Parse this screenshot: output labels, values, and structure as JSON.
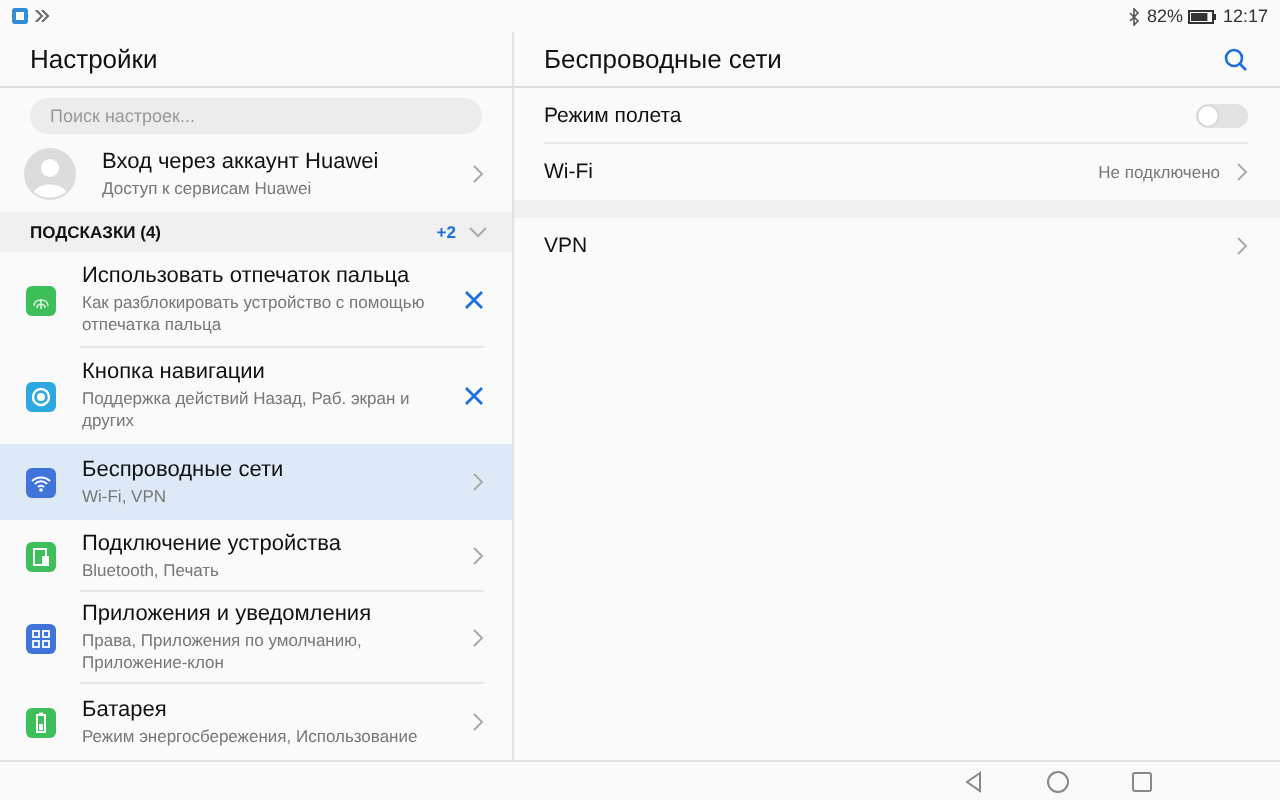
{
  "status_bar": {
    "battery": "82%",
    "time": "12:17"
  },
  "sidebar": {
    "title": "Настройки",
    "search": {
      "placeholder": "Поиск настроек..."
    },
    "account": {
      "title": "Вход через аккаунт Huawei",
      "subtitle": "Доступ к сервисам Huawei"
    },
    "section": {
      "title": "ПОДСКАЗКИ (4)",
      "count": "+2",
      "expanded": false
    },
    "items": [
      {
        "kind": "suggestion",
        "color": "#3dbf5a",
        "title": "Использовать отпечаток пальца",
        "subtitle": "Как разблокировать устройство с помощью отпечатка пальца",
        "selected": false
      },
      {
        "kind": "suggestion",
        "color": "#2ea8e0",
        "title": "Кнопка навигации",
        "subtitle": "Поддержка действий Назад, Раб. экран и других",
        "selected": false
      },
      {
        "kind": "setting",
        "color": "#3f74d9",
        "title": "Беспроводные сети",
        "subtitle": "Wi-Fi, VPN",
        "selected": true
      },
      {
        "kind": "setting",
        "color": "#3dbf5a",
        "title": "Подключение устройства",
        "subtitle": "Bluetooth, Печать",
        "selected": false
      },
      {
        "kind": "setting",
        "color": "#3f74d9",
        "title": "Приложения и уведомления",
        "subtitle": "Права, Приложения по умолчанию, Приложение-клон",
        "selected": false
      },
      {
        "kind": "setting",
        "color": "#3dbf5a",
        "title": "Батарея",
        "subtitle": "Режим энергосбережения, Использование",
        "selected": false
      }
    ]
  },
  "detail": {
    "title": "Беспроводные сети",
    "groups": [
      [
        {
          "kind": "toggle",
          "label": "Режим полета",
          "on": false
        },
        {
          "kind": "link",
          "label": "Wi-Fi",
          "value": "Не подключено"
        }
      ],
      [
        {
          "kind": "link",
          "label": "VPN"
        }
      ]
    ]
  }
}
